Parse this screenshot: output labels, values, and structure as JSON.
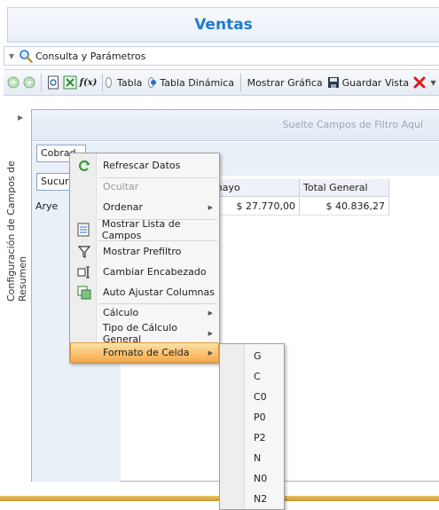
{
  "app": {
    "title": "Ventas"
  },
  "consulta": {
    "label": "Consulta y Parámetros"
  },
  "toolbar": {
    "radio_tabla": "Tabla",
    "radio_dinamica": "Tabla Dinámica",
    "selected_view": "Tabla Dinámica",
    "mostrar_grafica": "Mostrar Gráfica",
    "guardar_vista": "Guardar Vista"
  },
  "side_panel": {
    "label": "Configuración de Campos de Resumen"
  },
  "pivot": {
    "filter_hint": "Suelte Campos de Filtro Aquí",
    "field_cobrador": "Cobrad",
    "field_sucursal": "Sucurs",
    "header_mayo": "mayo",
    "header_total": "Total General",
    "row_label": "Arye",
    "value_mayo": "$ 27.770,00",
    "value_total": "$ 40.836,27"
  },
  "context_menu": {
    "items": [
      {
        "label": "Refrescar Datos",
        "icon": "refresh-icon"
      },
      {
        "label": "Ocultar",
        "disabled": true
      },
      {
        "label": "Ordenar",
        "submenu": true
      },
      {
        "label": "Mostrar Lista de Campos",
        "icon": "field-list-icon"
      },
      {
        "label": "Mostrar Prefiltro",
        "icon": "filter-icon"
      },
      {
        "label": "Cambiar Encabezado",
        "icon": "rename-icon"
      },
      {
        "label": "Auto Ajustar Columnas",
        "icon": "auto-fit-icon"
      },
      {
        "label": "Cálculo",
        "submenu": true
      },
      {
        "label": "Tipo de Cálculo General",
        "submenu": true
      },
      {
        "label": "Formato de Celda",
        "submenu": true,
        "highlighted": true
      }
    ]
  },
  "format_submenu": {
    "items": [
      "G",
      "C",
      "C0",
      "P0",
      "P2",
      "N",
      "N0",
      "N2"
    ]
  },
  "colors": {
    "accent": "#1f7bd0",
    "highlight": "#f7a94a"
  }
}
